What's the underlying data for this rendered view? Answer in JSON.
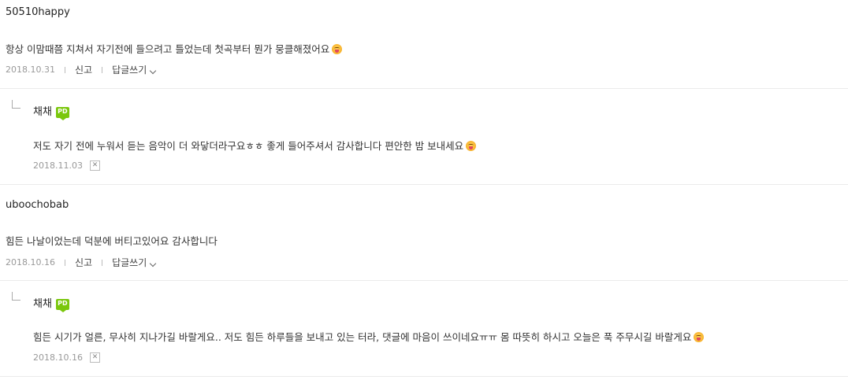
{
  "comments": [
    {
      "author": "50510happy",
      "text": "항상 이맘때쯤 지쳐서 자기전에 들으려고 틀었는데 첫곡부터 뭔가 뭉클해졌어요",
      "emoji": "smiling-face-icon",
      "date": "2018.10.31",
      "report_label": "신고",
      "reply_label": "답글쓰기",
      "reply": {
        "author": "채채",
        "badge": "PD",
        "text": "저도 자기 전에 누워서 듣는 음악이 더 와닿더라구요ㅎㅎ 좋게 들어주셔서 감사합니다 편안한 밤 보내세요",
        "emoji": "smiling-face-icon",
        "date": "2018.11.03",
        "delete_icon": "x-delete-icon"
      }
    },
    {
      "author": "uboochobab",
      "text": "힘든 나날이었는데 덕분에 버티고있어요 감사합니다",
      "date": "2018.10.16",
      "report_label": "신고",
      "reply_label": "답글쓰기",
      "reply": {
        "author": "채채",
        "badge": "PD",
        "text": "힘든 시기가 얼른, 무사히 지나가길 바랄게요.. 저도 힘든 하루들을 보내고 있는 터라, 댓글에 마음이 쓰이네요ㅠㅠ 몸 따뜻히 하시고 오늘은 푹 주무시길 바랄게요",
        "emoji": "smiling-face-icon",
        "date": "2018.10.16",
        "delete_icon": "x-delete-icon"
      }
    }
  ],
  "colors": {
    "badge": "#7ac70c",
    "divider": "#ebebeb",
    "date": "#999999"
  }
}
